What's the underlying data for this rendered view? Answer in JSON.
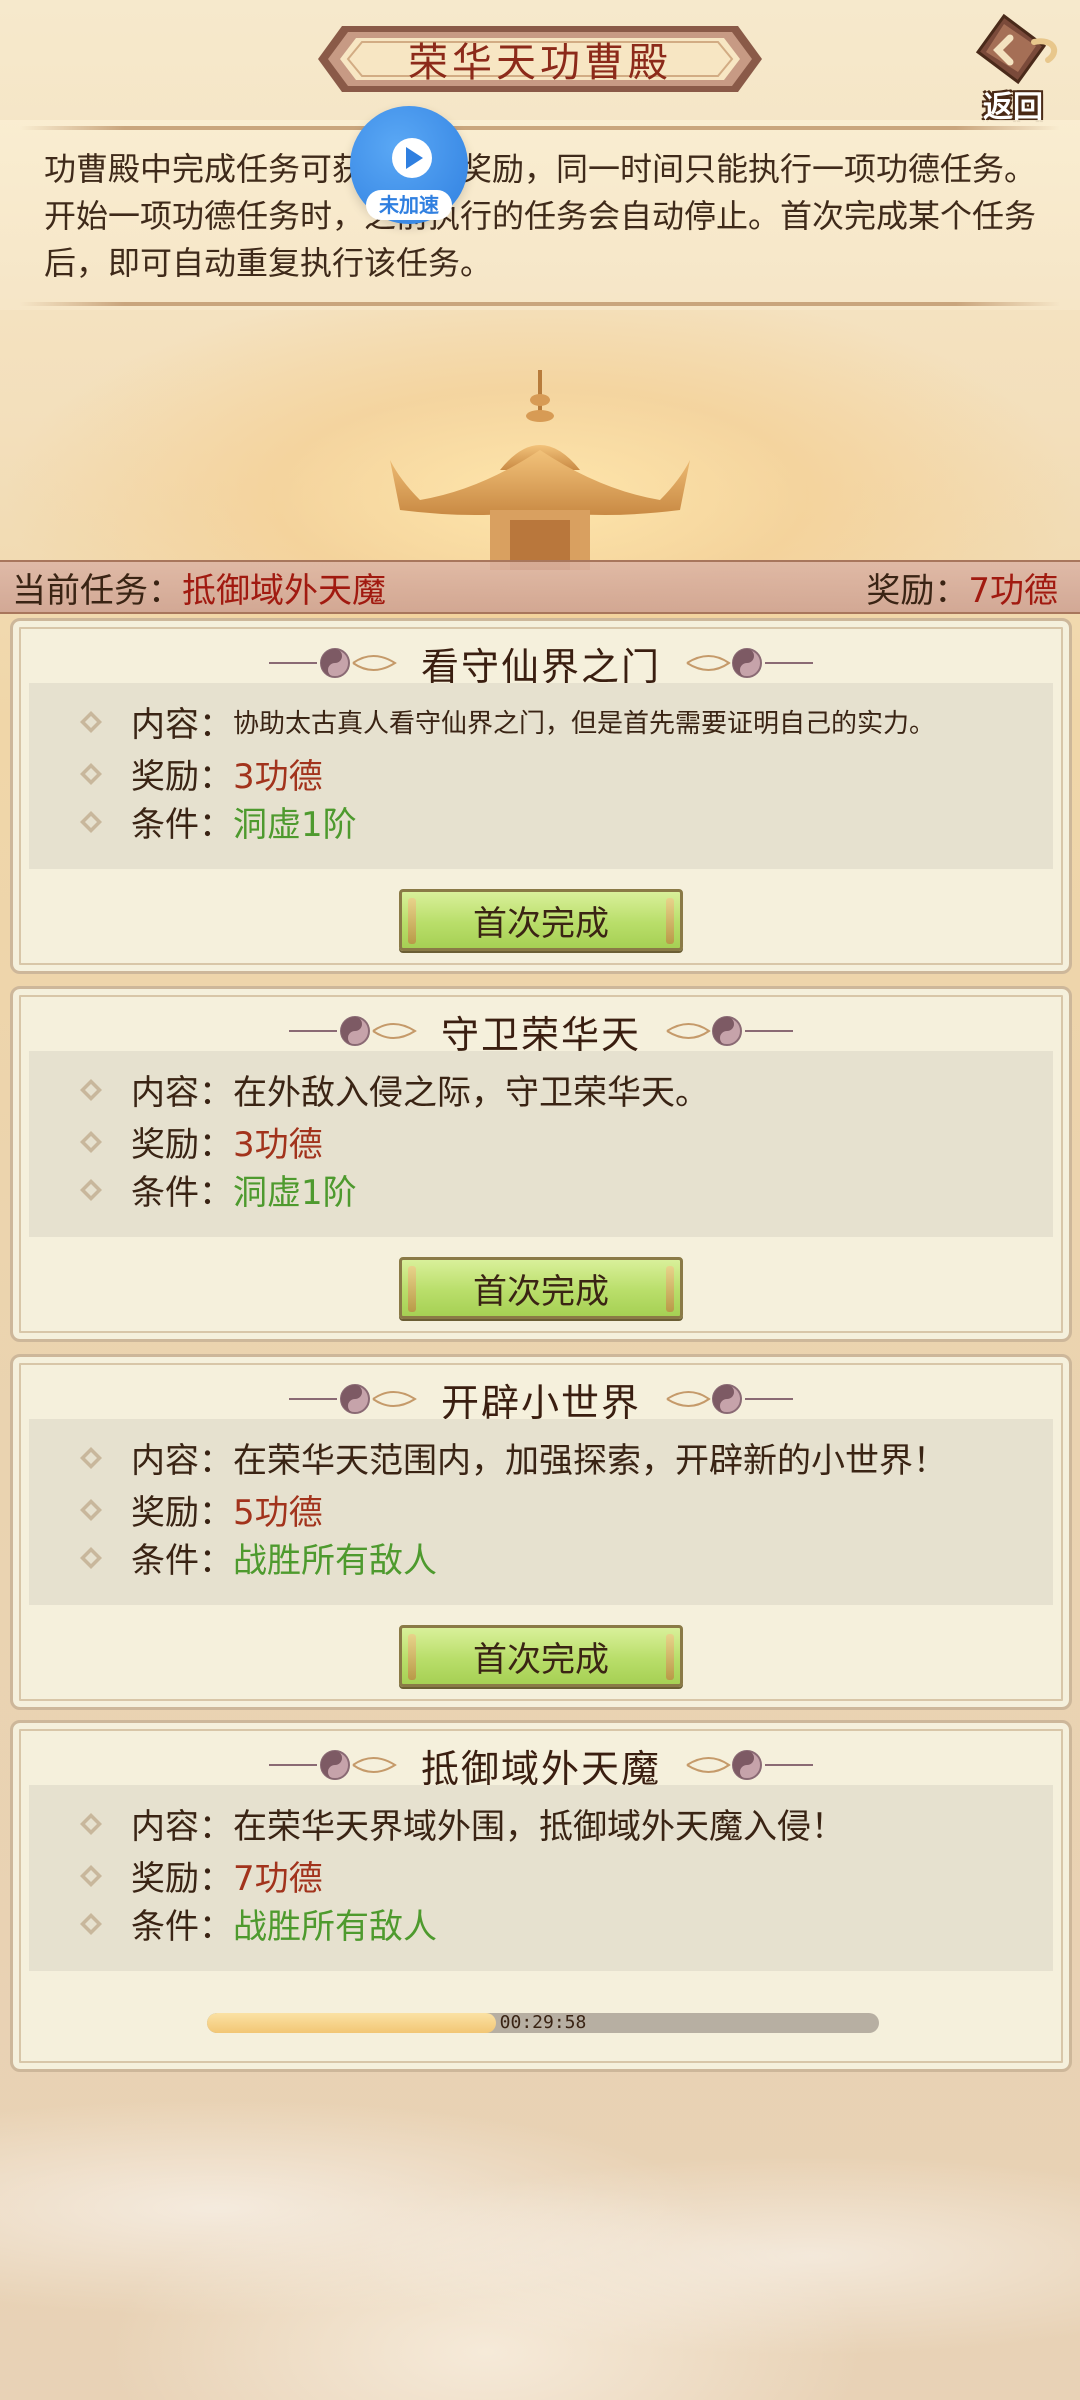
{
  "header": {
    "title": "荣华天功曹殿",
    "back_label": "返回"
  },
  "description": {
    "text": "功曹殿中完成任务可获得功德奖励，同一时间只能执行一项功德任务。开始一项功德任务时，之前执行的任务会自动停止。首次完成某个任务后，即可自动重复执行该任务。"
  },
  "speed_widget": {
    "label": "未加速"
  },
  "current_task": {
    "label": "当前任务：",
    "name": "抵御域外天魔",
    "reward_label": "奖励：",
    "reward_value": "7功德"
  },
  "labels": {
    "content": "内容：",
    "reward": "奖励：",
    "condition": "条件："
  },
  "tasks": [
    {
      "title": "看守仙界之门",
      "content": "协助太古真人看守仙界之门，但是首先需要证明自己的实力。",
      "reward": "3功德",
      "condition": "洞虚1阶",
      "button": "首次完成"
    },
    {
      "title": "守卫荣华天",
      "content": "在外敌入侵之际，守卫荣华天。",
      "reward": "3功德",
      "condition": "洞虚1阶",
      "button": "首次完成"
    },
    {
      "title": "开辟小世界",
      "content": "在荣华天范围内，加强探索，开辟新的小世界！",
      "reward": "5功德",
      "condition": "战胜所有敌人",
      "button": "首次完成"
    },
    {
      "title": "抵御域外天魔",
      "content": "在荣华天界域外围，抵御域外天魔入侵！",
      "reward": "7功德",
      "condition": "战胜所有敌人",
      "timer": "00:29:58",
      "progress": 0.43
    }
  ],
  "colors": {
    "title_red": "#8c2a1a",
    "reward_red": "#a2331c",
    "condition_green": "#4e9a2e",
    "button_green": "#b9de6a"
  }
}
